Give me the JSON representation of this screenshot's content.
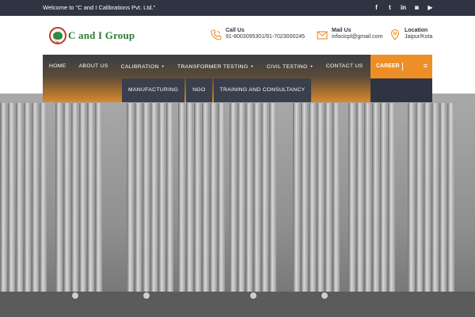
{
  "topbar": {
    "welcome": "Welcome to \"C and I Calibrations Pvt. Ltd.\"",
    "social": [
      {
        "icon": "facebook-icon",
        "glyph": "f"
      },
      {
        "icon": "twitter-icon",
        "glyph": "t"
      },
      {
        "icon": "linkedin-icon",
        "glyph": "in"
      },
      {
        "icon": "flickr-icon",
        "glyph": "◙"
      },
      {
        "icon": "youtube-icon",
        "glyph": "▶"
      }
    ]
  },
  "logo": {
    "badge": "C&I",
    "text": "C and I Group"
  },
  "contacts": {
    "call": {
      "title": "Call Us",
      "value": "91-8003095301/91-7023000245",
      "icon": "phone-icon"
    },
    "mail": {
      "title": "Mail Us",
      "value": "infocicpl@gmail.com",
      "icon": "envelope-icon"
    },
    "location": {
      "title": "Location",
      "value": "Jaipur/Kota",
      "icon": "map-pin-icon"
    }
  },
  "nav": {
    "home": "HOME",
    "about": "ABOUT US",
    "calibration": "CALIBRATION",
    "transformer": "TRANSFORMER TESTING",
    "civil": "CIVIL TESTING",
    "contact": "CONTACT US",
    "manufacturing": "MANUFACTURING",
    "ngo": "NGO",
    "training": "TRAINING AND CONSULTANCY",
    "caret": "▼",
    "career": "CAREER",
    "menu_glyph": "≡"
  },
  "colors": {
    "accent": "#ee8e27",
    "dark": "#2f3442",
    "brand_green": "#2a7d34",
    "brand_red": "#c0392b"
  }
}
